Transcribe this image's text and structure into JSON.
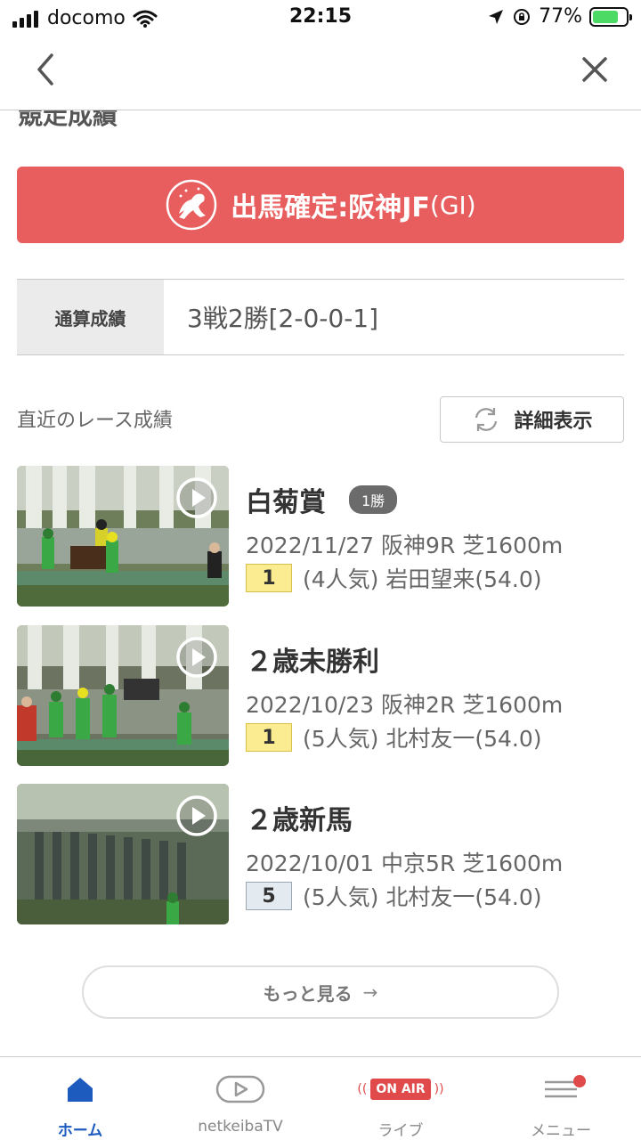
{
  "status_bar": {
    "carrier": "docomo",
    "time": "22:15",
    "battery_percent": "77%"
  },
  "page": {
    "section_heading": "競走成績"
  },
  "entry_banner": {
    "text": "出馬確定:阪神JF",
    "grade": "(GI)"
  },
  "record": {
    "label": "通算成績",
    "value": "3戦2勝[2-0-0-1]"
  },
  "recent": {
    "title": "直近のレース成績",
    "detail_button": "詳細表示"
  },
  "races": [
    {
      "name": "白菊賞",
      "badge": "1勝",
      "info": "2022/11/27 阪神9R 芝1600m",
      "rank": "1",
      "result": "(4人気) 岩田望来(54.0)"
    },
    {
      "name": "２歳未勝利",
      "badge": "",
      "info": "2022/10/23 阪神2R 芝1600m",
      "rank": "1",
      "result": "(5人気) 北村友一(54.0)"
    },
    {
      "name": "２歳新馬",
      "badge": "",
      "info": "2022/10/01 中京5R 芝1600m",
      "rank": "5",
      "result": "(5人気) 北村友一(54.0)"
    }
  ],
  "more_button": {
    "label": "もっと見る",
    "arrow": "→"
  },
  "tabs": [
    {
      "label": "ホーム",
      "icon": "home-icon",
      "active": true
    },
    {
      "label": "netkeibaTV",
      "icon": "tv-play-icon",
      "active": false
    },
    {
      "label": "ライブ",
      "icon": "on-air-icon",
      "badge_text": "ON AIR",
      "active": false
    },
    {
      "label": "メニュー",
      "icon": "menu-icon",
      "active": false
    }
  ],
  "colors": {
    "accent_red": "#e85d5d",
    "tab_active": "#1e5bbf",
    "win_rank_bg": "#fbeb91",
    "other_rank_bg": "#e3eaf0"
  }
}
